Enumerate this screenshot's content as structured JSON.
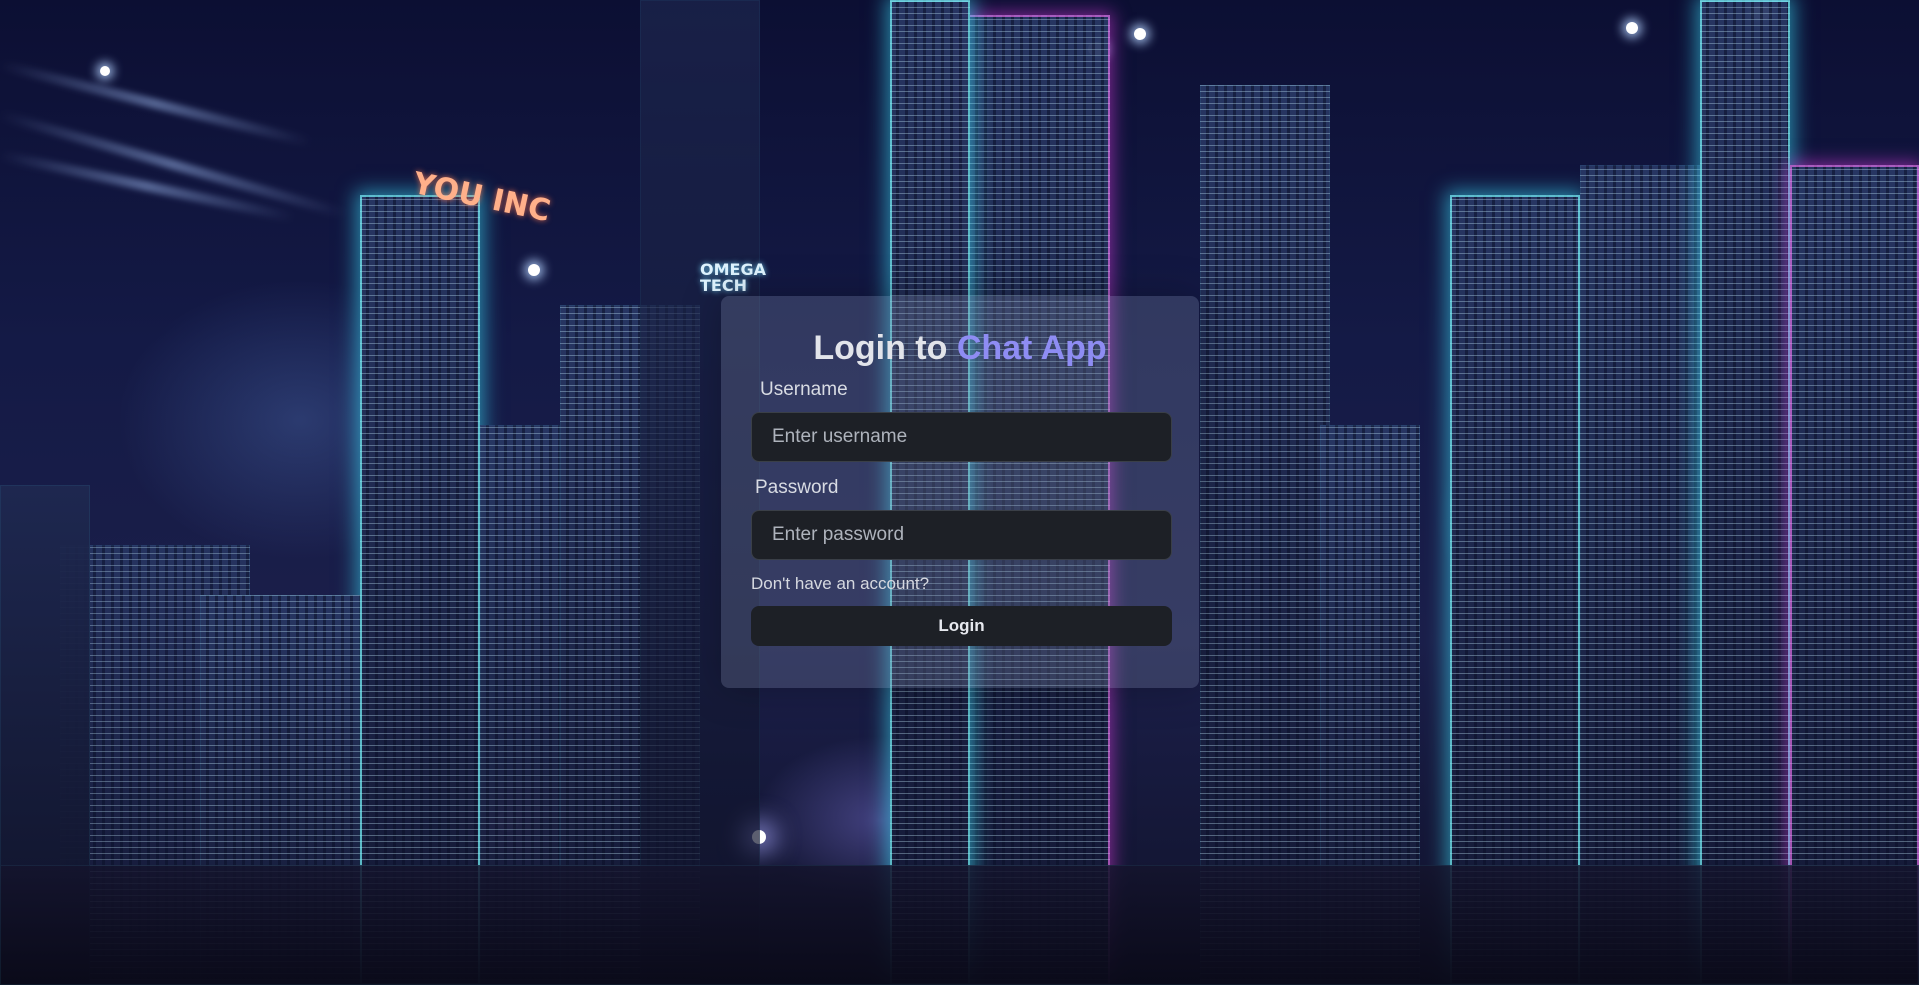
{
  "login": {
    "title_prefix": "Login to",
    "title_brand": "Chat App",
    "username_label": "Username",
    "username_placeholder": "Enter username",
    "password_label": "Password",
    "password_placeholder": "Enter password",
    "signup_link": "Don't have an account?",
    "login_button": "Login"
  },
  "background": {
    "description_icon": "cyberpunk-city-background",
    "sign_left": "YOU INC",
    "sign_center": "OMEGA TECH"
  },
  "colors": {
    "brand": "#8e8cf3",
    "input_bg": "#1d2026",
    "text": "#e2e4ea"
  }
}
